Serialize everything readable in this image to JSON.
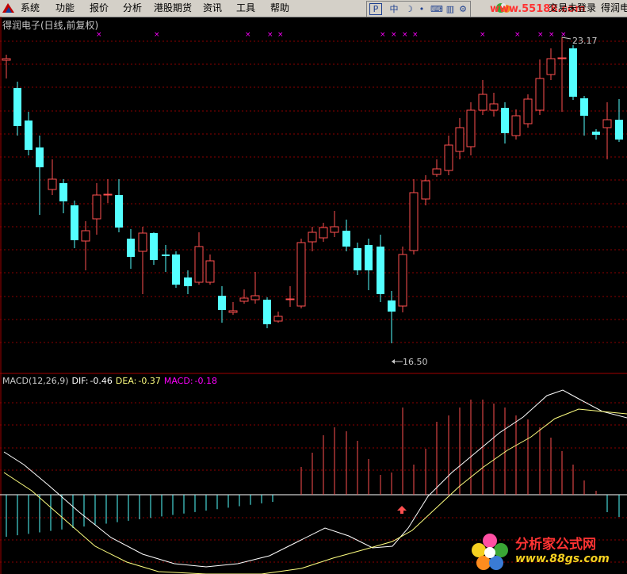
{
  "menu": {
    "items": [
      "系统",
      "功能",
      "报价",
      "分析",
      "港股期货",
      "资讯",
      "工具",
      "帮助"
    ],
    "toolbar": [
      "P",
      "中",
      "☽",
      "•",
      "⌨",
      "▥",
      "⚙"
    ],
    "watermark": "www.55188.com",
    "login_status": "交易未登录",
    "stock_short": "得润电"
  },
  "chart": {
    "title": "得润电子(日线,前复权)",
    "high_label": "23.17",
    "low_label": "16.50",
    "colors": {
      "up": "#ff5050",
      "down": "#54ffff",
      "grid": "#8b0000",
      "signal_marker": "#ff00ff",
      "separator": "#a00000",
      "dif_line": "#ffffff",
      "dea_line": "#ffff80",
      "macd_pos": "#ff5050",
      "macd_neg": "#54ffff"
    }
  },
  "macd": {
    "name": "MACD(12,26,9)",
    "dif_label": "DIF:",
    "dif_value": "-0.46",
    "dea_label": "DEA:",
    "dea_value": "-0.37",
    "macd_label": "MACD:",
    "macd_value": "-0.18"
  },
  "chart_data": {
    "type": "candlestick",
    "low": 16.5,
    "high": 23.17,
    "signals_shown": 16,
    "macd_last": {
      "dif": -0.46,
      "dea": -0.37,
      "macd": -0.18
    }
  },
  "footer_watermark": {
    "text": "分析家公式网",
    "url": "www.88gs.com"
  }
}
